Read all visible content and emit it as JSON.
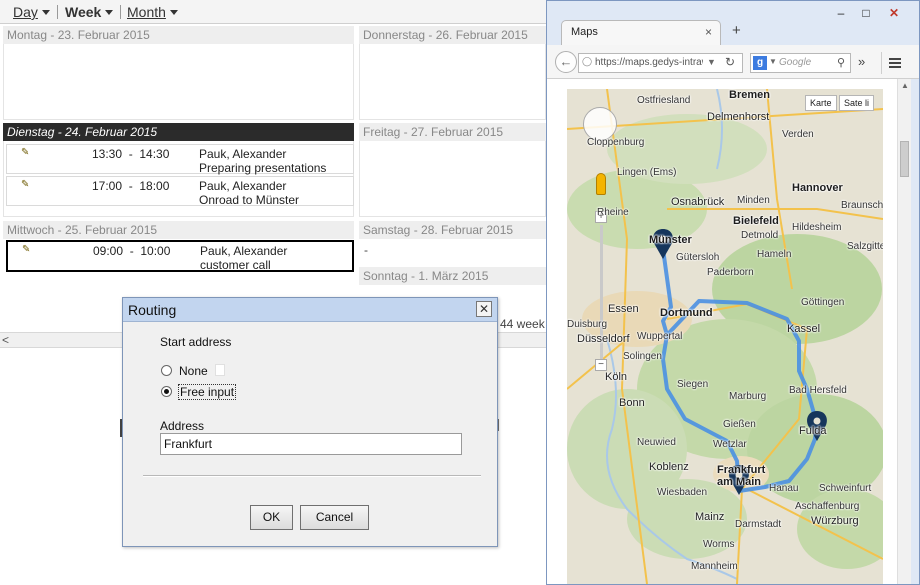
{
  "calendar": {
    "views": {
      "day": "Day",
      "week": "Week",
      "month": "Month"
    },
    "days": {
      "mon": "Montag - 23. Februar 2015",
      "tue": "Dienstag - 24. Februar 2015",
      "wed": "Mittwoch - 25. Februar 2015",
      "thu": "Donnerstag - 26. Februar 2015",
      "fri": "Freitag - 27. Februar 2015",
      "sat": "Samstag - 28. Februar 2015",
      "sun": "Sonntag - 1. März 2015"
    },
    "appointments": [
      {
        "time": "13:30  -  14:30",
        "who": "Pauk, Alexander",
        "desc": "Preparing presentations"
      },
      {
        "time": "17:00  -  18:00",
        "who": "Pauk, Alexander",
        "desc": "Onroad to Münster"
      },
      {
        "time": "09:00  -  10:00",
        "who": "Pauk, Alexander",
        "desc": "customer call"
      }
    ],
    "partial_week": "44 week",
    "sat_dash": "-"
  },
  "dialog": {
    "title": "Routing",
    "close_glyph": "✕",
    "start_address_label": "Start address",
    "option_none": "None",
    "option_free": "Free input",
    "selected_option": "Free input",
    "address_label": "Address",
    "address_value": "Frankfurt",
    "ok": "OK",
    "cancel": "Cancel"
  },
  "browser": {
    "tab_title": "Maps",
    "tab_close": "×",
    "new_tab": "+",
    "url": "https://maps.gedys-intrawer",
    "search_placeholder": "Google",
    "search_engine_glyph": "g",
    "more_glyph": "»",
    "win_min": "–",
    "win_max": "□",
    "win_close": "✕"
  },
  "map": {
    "type_buttons": [
      "Karte",
      "Sate li"
    ],
    "route_color": "#4a90e2",
    "pin_color": "#16365c",
    "labels": [
      {
        "t": "Bremen",
        "k": "city"
      },
      {
        "t": "Delmenhorst",
        "k": "big"
      },
      {
        "t": "Cloppenburg",
        "k": ""
      },
      {
        "t": "Verden",
        "k": ""
      },
      {
        "t": "Lingen (Ems)",
        "k": ""
      },
      {
        "t": "Osnabrück",
        "k": "big"
      },
      {
        "t": "Minden",
        "k": ""
      },
      {
        "t": "Hannover",
        "k": "city"
      },
      {
        "t": "Bielefeld",
        "k": "city"
      },
      {
        "t": "Detmold",
        "k": ""
      },
      {
        "t": "Münster",
        "k": "city"
      },
      {
        "t": "Gütersloh",
        "k": ""
      },
      {
        "t": "Paderborn",
        "k": ""
      },
      {
        "t": "Hildesheim",
        "k": ""
      },
      {
        "t": "Braunschw",
        "k": ""
      },
      {
        "t": "Göttingen",
        "k": ""
      },
      {
        "t": "Dortmund",
        "k": "city"
      },
      {
        "t": "Essen",
        "k": "big"
      },
      {
        "t": "Duisburg",
        "k": ""
      },
      {
        "t": "Düsseldorf",
        "k": "big"
      },
      {
        "t": "Solingen",
        "k": ""
      },
      {
        "t": "Wuppertal",
        "k": ""
      },
      {
        "t": "Kassel",
        "k": "big"
      },
      {
        "t": "Köln",
        "k": "big"
      },
      {
        "t": "Siegen",
        "k": ""
      },
      {
        "t": "Bonn",
        "k": "big"
      },
      {
        "t": "Marburg",
        "k": ""
      },
      {
        "t": "Bad Hersfeld",
        "k": ""
      },
      {
        "t": "Gießen",
        "k": ""
      },
      {
        "t": "Fulda",
        "k": "big"
      },
      {
        "t": "Neuwied",
        "k": ""
      },
      {
        "t": "Koblenz",
        "k": "big"
      },
      {
        "t": "Wetzlar",
        "k": ""
      },
      {
        "t": "Frankfurt am Main",
        "k": "city"
      },
      {
        "t": "Wiesbaden",
        "k": ""
      },
      {
        "t": "Hanau",
        "k": ""
      },
      {
        "t": "Schweinfurt",
        "k": ""
      },
      {
        "t": "Mainz",
        "k": "big"
      },
      {
        "t": "Darmstadt",
        "k": ""
      },
      {
        "t": "Aschaffenburg",
        "k": ""
      },
      {
        "t": "Würzburg",
        "k": "big"
      },
      {
        "t": "Worms",
        "k": ""
      },
      {
        "t": "Mannheim",
        "k": ""
      },
      {
        "t": "Ostfriesland",
        "k": ""
      },
      {
        "t": "Salzgitter",
        "k": ""
      },
      {
        "t": "Hameln",
        "k": ""
      },
      {
        "t": "Rheine",
        "k": ""
      }
    ]
  }
}
